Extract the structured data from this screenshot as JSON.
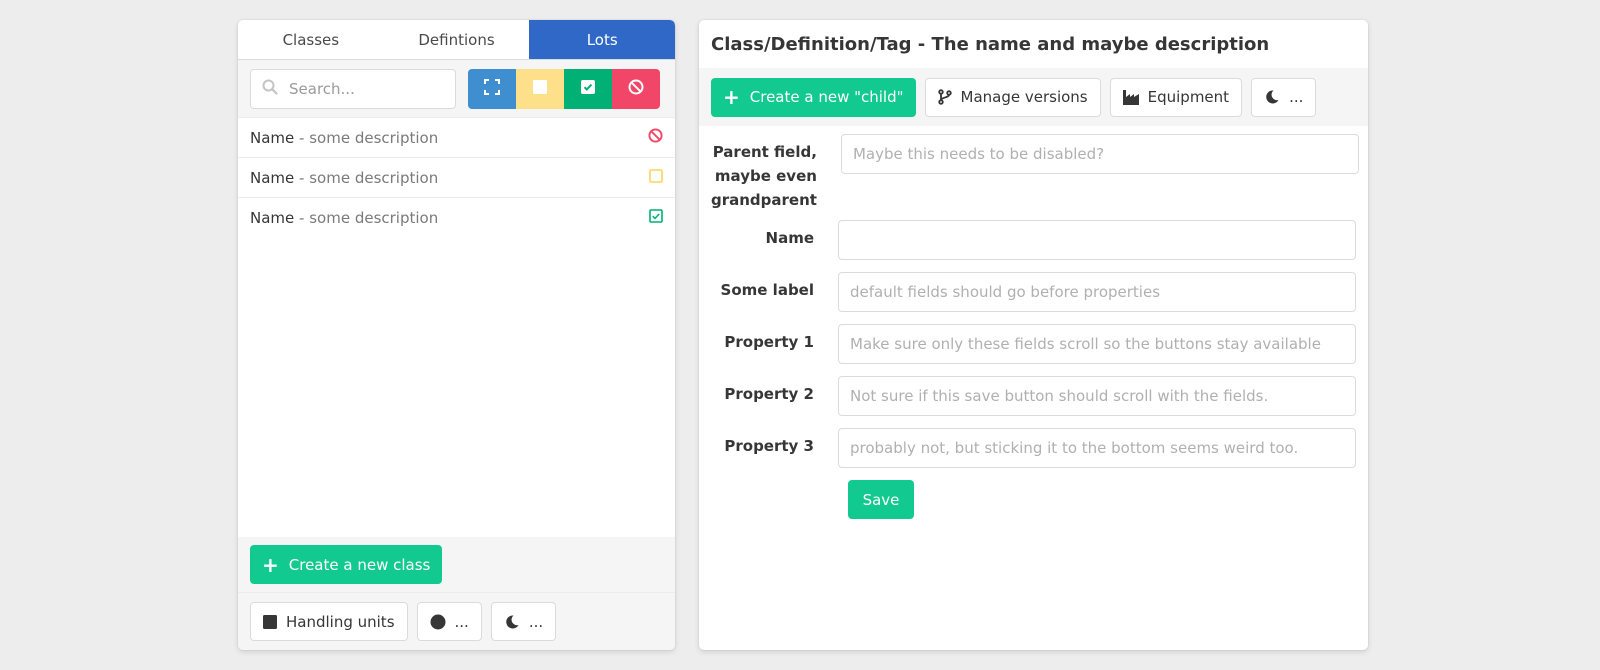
{
  "left": {
    "tabs": [
      {
        "label": "Classes"
      },
      {
        "label": "Defintions"
      },
      {
        "label": "Lots"
      }
    ],
    "search": {
      "placeholder": "Search...",
      "value": ""
    },
    "filters": [
      {
        "icon": "expand-icon",
        "color": "#3e8ed0"
      },
      {
        "icon": "square-filled-icon",
        "color": "#ffe08a"
      },
      {
        "icon": "check-square-icon",
        "color": "#00b074"
      },
      {
        "icon": "ban-icon",
        "color": "#f14668"
      }
    ],
    "items": [
      {
        "name": "Name",
        "desc": " - some description",
        "status_icon": "ban-icon",
        "status_color": "#f14668"
      },
      {
        "name": "Name",
        "desc": " - some description",
        "status_icon": "square-outline-icon",
        "status_color": "#ffe08a"
      },
      {
        "name": "Name",
        "desc": " - some description",
        "status_icon": "check-square-icon",
        "status_color": "#00b074"
      }
    ],
    "create_label": "Create a new class",
    "bottom_buttons": [
      {
        "label": "Handling units",
        "icon": "square-filled-icon"
      },
      {
        "label": "...",
        "icon": "circle-icon"
      },
      {
        "label": "...",
        "icon": "moon-icon"
      }
    ]
  },
  "right": {
    "title": "Class/Definition/Tag - The name and maybe description",
    "toolbar": {
      "create_child": "Create a new \"child\"",
      "manage_versions": "Manage versions",
      "equipment": "Equipment",
      "more": "..."
    },
    "fields": [
      {
        "label": "Parent field, maybe even grandparent",
        "placeholder": "Maybe this needs to be disabled?",
        "value": ""
      },
      {
        "label": "Name",
        "placeholder": "",
        "value": ""
      },
      {
        "label": "Some label",
        "placeholder": "default fields should go before properties",
        "value": ""
      },
      {
        "label": "Property 1",
        "placeholder": "Make sure only these fields scroll so the buttons stay available",
        "value": ""
      },
      {
        "label": "Property 2",
        "placeholder": "Not sure if this save button should scroll with the fields.",
        "value": ""
      },
      {
        "label": "Property 3",
        "placeholder": "probably not, but sticking it to the bottom seems weird too.",
        "value": ""
      }
    ],
    "save_label": "Save"
  },
  "colors": {
    "accent_green": "#12c98f",
    "tab_active": "#3068c8",
    "background": "#ededed"
  }
}
